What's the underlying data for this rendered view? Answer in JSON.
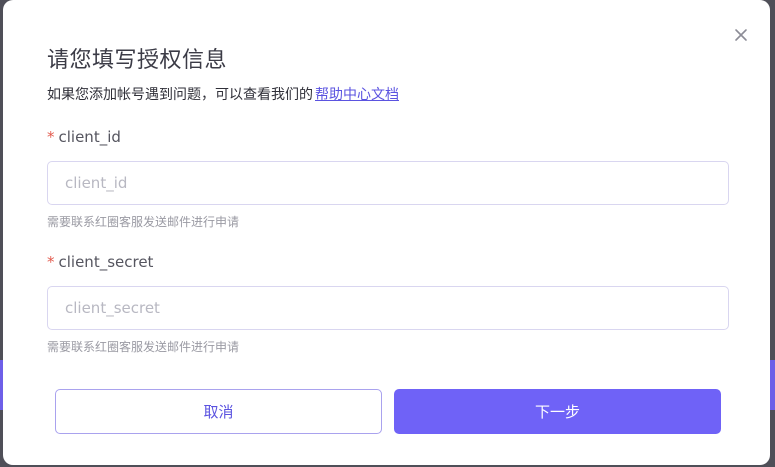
{
  "dialog": {
    "title": "请您填写授权信息",
    "subtitle_text": "如果您添加帐号遇到问题，可以查看我们的",
    "help_link": "帮助中心文档",
    "close_icon": "close-icon"
  },
  "fields": [
    {
      "required_mark": "*",
      "label": "client_id",
      "value": "",
      "placeholder": "client_id",
      "hint": "需要联系红圈客服发送邮件进行申请"
    },
    {
      "required_mark": "*",
      "label": "client_secret",
      "value": "",
      "placeholder": "client_secret",
      "hint": "需要联系红圈客服发送邮件进行申请"
    }
  ],
  "buttons": {
    "cancel_label": "取消",
    "next_label": "下一步"
  },
  "colors": {
    "accent": "#6f62f7",
    "link": "#5b53e0",
    "required": "#e25b4e"
  }
}
